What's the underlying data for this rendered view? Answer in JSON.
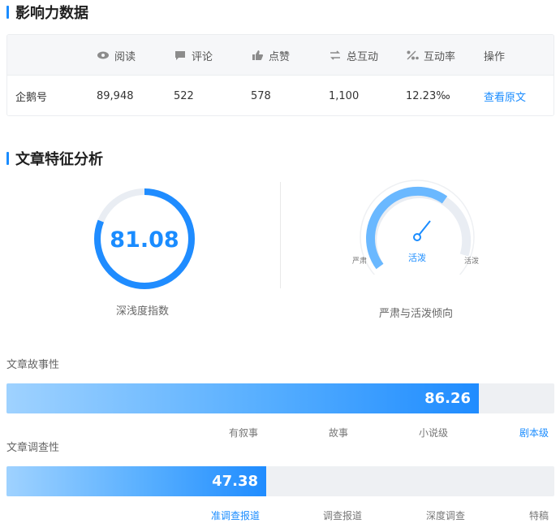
{
  "influence": {
    "title": "影响力数据",
    "headers": {
      "read": "阅读",
      "comment": "评论",
      "like": "点赞",
      "interact": "总互动",
      "rate": "互动率",
      "action": "操作"
    },
    "row": {
      "platform": "企鹅号",
      "read": "89,948",
      "comment": "522",
      "like": "578",
      "interact": "1,100",
      "rate": "12.23‰",
      "action": "查看原文"
    }
  },
  "features": {
    "title": "文章特征分析",
    "depth": {
      "value": "81.08",
      "caption": "深浅度指数",
      "fraction": 0.8108
    },
    "tone": {
      "current": "活泼",
      "left": "严肃",
      "right": "活泼",
      "caption": "严肃与活泼倾向"
    }
  },
  "story": {
    "label": "文章故事性",
    "value": "86.26",
    "fraction": 0.8626,
    "levels": [
      "有叙事",
      "故事",
      "小说级",
      "剧本级"
    ],
    "active_level": 3
  },
  "investigation": {
    "label": "文章调查性",
    "value": "47.38",
    "fraction": 0.4738,
    "levels": [
      "准调查报道",
      "调查报道",
      "深度调查",
      "特稿"
    ],
    "active_level": 0
  },
  "colors": {
    "accent": "#1a8cff",
    "track": "#eef0f3",
    "ring_bg": "#e9edf3"
  }
}
